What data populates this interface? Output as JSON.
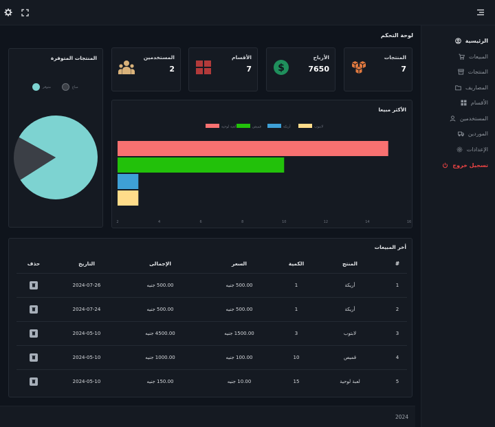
{
  "sidebar": {
    "items": [
      {
        "label": "الرئيسية",
        "icon": "user-circle-icon",
        "state": "active"
      },
      {
        "label": "المبيعات",
        "icon": "cart-icon"
      },
      {
        "label": "المنتجات",
        "icon": "box-icon"
      },
      {
        "label": "المصاريف",
        "icon": "folder-icon"
      },
      {
        "label": "الأقسام",
        "icon": "grid-icon"
      },
      {
        "label": "المستخدمين",
        "icon": "user-icon"
      },
      {
        "label": "الموردين",
        "icon": "truck-icon"
      },
      {
        "label": "الإعدادات",
        "icon": "gear-icon"
      },
      {
        "label": "تسجيل خروج",
        "icon": "power-icon",
        "state": "danger"
      }
    ]
  },
  "page": {
    "title": "لوحة التحكم"
  },
  "stats": [
    {
      "label": "المنتجات",
      "value": "7",
      "icon": "boxes-icon",
      "color": "#e0793f"
    },
    {
      "label": "الأرباح",
      "value": "7650",
      "icon": "dollar-icon",
      "color": "#1f8f5c"
    },
    {
      "label": "الأقسام",
      "value": "7",
      "icon": "grid-icon",
      "color": "#b23a3a"
    },
    {
      "label": "المستخدمين",
      "value": "2",
      "icon": "users-icon",
      "color": "#d9b27a"
    }
  ],
  "pie_card": {
    "title": "المنتجات المتوفرة",
    "legend": [
      {
        "label": "متوفر",
        "color": "#7dd3d1"
      },
      {
        "label": "مباع",
        "color": "#3b3f46"
      }
    ]
  },
  "bar_card": {
    "title": "الأكثر مبيعا"
  },
  "chart_data": [
    {
      "type": "bar",
      "orientation": "horizontal",
      "categories": [
        "لعبة لوحية",
        "قميص",
        "أريكة",
        "لابتوب"
      ],
      "values": [
        15,
        10,
        3,
        3
      ],
      "colors": [
        "#f87171",
        "#22c10a",
        "#3ea0d6",
        "#ffdc8a"
      ],
      "xlim": [
        2,
        16
      ],
      "xticks": [
        "2",
        "4",
        "6",
        "8",
        "10",
        "12",
        "14",
        "16"
      ],
      "legend_position": "top"
    },
    {
      "type": "pie",
      "categories": [
        "متوفر",
        "مباع"
      ],
      "values": [
        83,
        17
      ],
      "colors": [
        "#7dd3d1",
        "#3b3f46"
      ],
      "legend_position": "top"
    }
  ],
  "sales": {
    "title": "أخر المبيعات",
    "columns": [
      "#",
      "المنتج",
      "الكمية",
      "السعر",
      "الإجمالى",
      "التاريخ",
      "حذف"
    ],
    "rows": [
      [
        "1",
        "أريكة",
        "1",
        "500.00 جنيه",
        "500.00 جنيه",
        "2024-07-26"
      ],
      [
        "2",
        "أريكة",
        "1",
        "500.00 جنيه",
        "500.00 جنيه",
        "2024-07-24"
      ],
      [
        "3",
        "لابتوب",
        "3",
        "1500.00 جنيه",
        "4500.00 جنيه",
        "2024-05-10"
      ],
      [
        "4",
        "قميص",
        "10",
        "100.00 جنيه",
        "1000.00 جنيه",
        "2024-05-10"
      ],
      [
        "5",
        "لعبة لوحية",
        "15",
        "10.00 جنيه",
        "150.00 جنيه",
        "2024-05-10"
      ]
    ]
  },
  "footer": {
    "text": "2024"
  }
}
